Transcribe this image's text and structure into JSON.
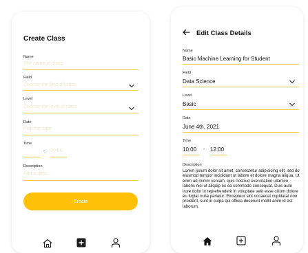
{
  "create_screen": {
    "title": "Create Class",
    "fields": [
      {
        "label": "Name",
        "placeholder": "The name of class"
      },
      {
        "label": "Field",
        "placeholder": "Choose the field of class"
      },
      {
        "label": "Level",
        "placeholder": "Choose the level of class"
      },
      {
        "label": "Date",
        "placeholder": "Pick the date"
      },
      {
        "label": "Time",
        "start_placeholder": "",
        "end_placeholder": "00:00",
        "separator": "-"
      },
      {
        "label": "Description",
        "placeholder": "Add a desc"
      }
    ],
    "create_button_label": "Create",
    "nav": [
      "home-icon",
      "add-square-icon",
      "profile-icon"
    ]
  },
  "edit_screen": {
    "title": "Edit Class Details",
    "fields": [
      {
        "label": "Name",
        "value": "Basic Machine Learning for Student"
      },
      {
        "label": "Field",
        "value": "Data Science"
      },
      {
        "label": "Level",
        "value": "Basic"
      },
      {
        "label": "Date",
        "value": "June 4th, 2021"
      },
      {
        "label": "Time",
        "start": "10:00",
        "separator": "-",
        "end": "12:00"
      },
      {
        "label": "Description",
        "value": "Lorem ipsum dolor sit amet, consectetur adipisicing elit, sed do eiusmod tempor incididunt ut labore et dolore magna aliqua. Ut enim ad minim veniam, quis nostrud exercitation ullamco laboris nisi ut aliquip ex ea commodo consequat. Duis aute irure dolor in reprehenderit in voluptate velit esse cillum dolore eu fugiat nulla pariatur. Excepteur sint occaecat cupidatat non proident, sunt in culpa qui officia deserunt mollit anim id est laborum."
      }
    ],
    "nav": [
      "home-filled-icon",
      "add-square-outline-icon",
      "profile-icon"
    ]
  },
  "colors": {
    "accent": "#ffc107",
    "underline": "#f7cf4a",
    "placeholder": "#ede6c8",
    "text": "#111111"
  }
}
